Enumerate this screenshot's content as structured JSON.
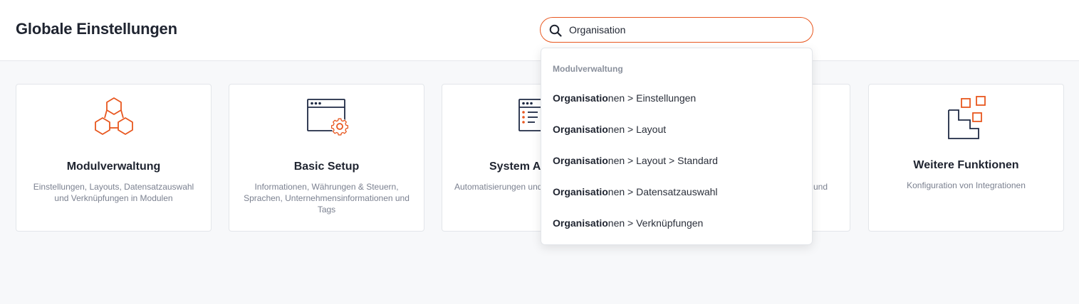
{
  "header": {
    "title": "Globale Einstellungen"
  },
  "search": {
    "value": "Organisation",
    "icon": "search-icon"
  },
  "cards": [
    {
      "title": "Modulverwaltung",
      "description": "Einstellungen, Layouts, Datensatzauswahl und Verknüpfungen in Modulen",
      "icon": "hexagon-modules-icon"
    },
    {
      "title": "Basic Setup",
      "description": "Informationen, Währungen & Steuern, Sprachen, Unternehmensinformationen und Tags",
      "icon": "window-gear-icon"
    },
    {
      "title": "System Au",
      "description": "Automatisierungen und",
      "icon": "checklist-window-icon"
    },
    {
      "title": "",
      "description": "und",
      "icon": ""
    },
    {
      "title": "Weitere Funktionen",
      "description": "Konfiguration von Integrationen",
      "icon": "stairs-blocks-icon"
    }
  ],
  "dropdown": {
    "group_label": "Modulverwaltung",
    "items": [
      {
        "match": "Organisatio",
        "rest": "nen > Einstellungen"
      },
      {
        "match": "Organisatio",
        "rest": "nen > Layout"
      },
      {
        "match": "Organisatio",
        "rest": "nen > Layout > Standard"
      },
      {
        "match": "Organisatio",
        "rest": "nen > Datensatzauswahl"
      },
      {
        "match": "Organisatio",
        "rest": "nen > Verknüpfungen"
      }
    ]
  },
  "colors": {
    "accent": "#e8571f",
    "navy": "#1f2a44"
  }
}
